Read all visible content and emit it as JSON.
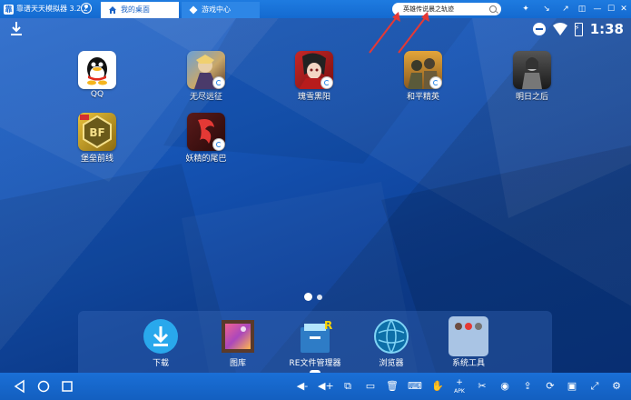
{
  "title_bar": {
    "app_title": "靠谱天天模拟器 3.2.2",
    "tabs": [
      {
        "label": "我的桌面",
        "active": true
      },
      {
        "label": "游戏中心",
        "active": false
      }
    ],
    "search_value": "英雄传说晨之轨迹",
    "controls": [
      "pin-icon",
      "shrink-icon",
      "expand-icon",
      "restore-icon",
      "minimize-icon",
      "maximize-icon",
      "close-icon"
    ]
  },
  "status_bar": {
    "time": "1:38",
    "icons": [
      "download-icon",
      "do-not-disturb-icon",
      "wifi-icon",
      "battery-charging-icon"
    ]
  },
  "desktop": {
    "apps": [
      {
        "label": "QQ",
        "icon": "qq-icon"
      },
      {
        "label": "无尽远征",
        "icon": "wujin-yuanzheng-icon"
      },
      {
        "label": "瑰雪黑阳",
        "icon": "guixue-heiyang-icon"
      },
      {
        "label": "和平精英",
        "icon": "heping-jingying-icon"
      },
      {
        "label": "明日之后",
        "icon": "mingri-zhihou-icon"
      },
      {
        "label": "堡垒前线",
        "icon": "baolei-qianxian-icon"
      },
      {
        "label": "妖精的尾巴",
        "icon": "yaojing-weiba-icon"
      }
    ],
    "page_indicator": {
      "pages": 2,
      "current": 1
    }
  },
  "dock": {
    "items": [
      {
        "label": "下载",
        "icon": "download-app-icon"
      },
      {
        "label": "图库",
        "icon": "gallery-icon"
      },
      {
        "label": "RE文件管理器",
        "icon": "re-file-manager-icon"
      },
      {
        "label": "浏览器",
        "icon": "browser-icon"
      },
      {
        "label": "系统工具",
        "icon": "system-tools-folder-icon"
      }
    ]
  },
  "nav_bar": {
    "buttons": [
      "back-icon",
      "home-icon",
      "recents-icon"
    ],
    "tools": [
      "volume-down-icon",
      "volume-up-icon",
      "multi-instance-icon",
      "folder-icon",
      "trash-icon",
      "keyboard-icon",
      "shake-icon",
      "apk-install-icon",
      "screenshot-icon",
      "location-icon",
      "share-icon",
      "rotate-icon",
      "screen-icon",
      "fullscreen-icon",
      "settings-icon"
    ],
    "apk_label": "APK"
  },
  "colors": {
    "titlebar": "#1a74dc",
    "desktop": "#1553b3",
    "navbar": "#135fc0",
    "annotation_arrows": "#e53935"
  }
}
